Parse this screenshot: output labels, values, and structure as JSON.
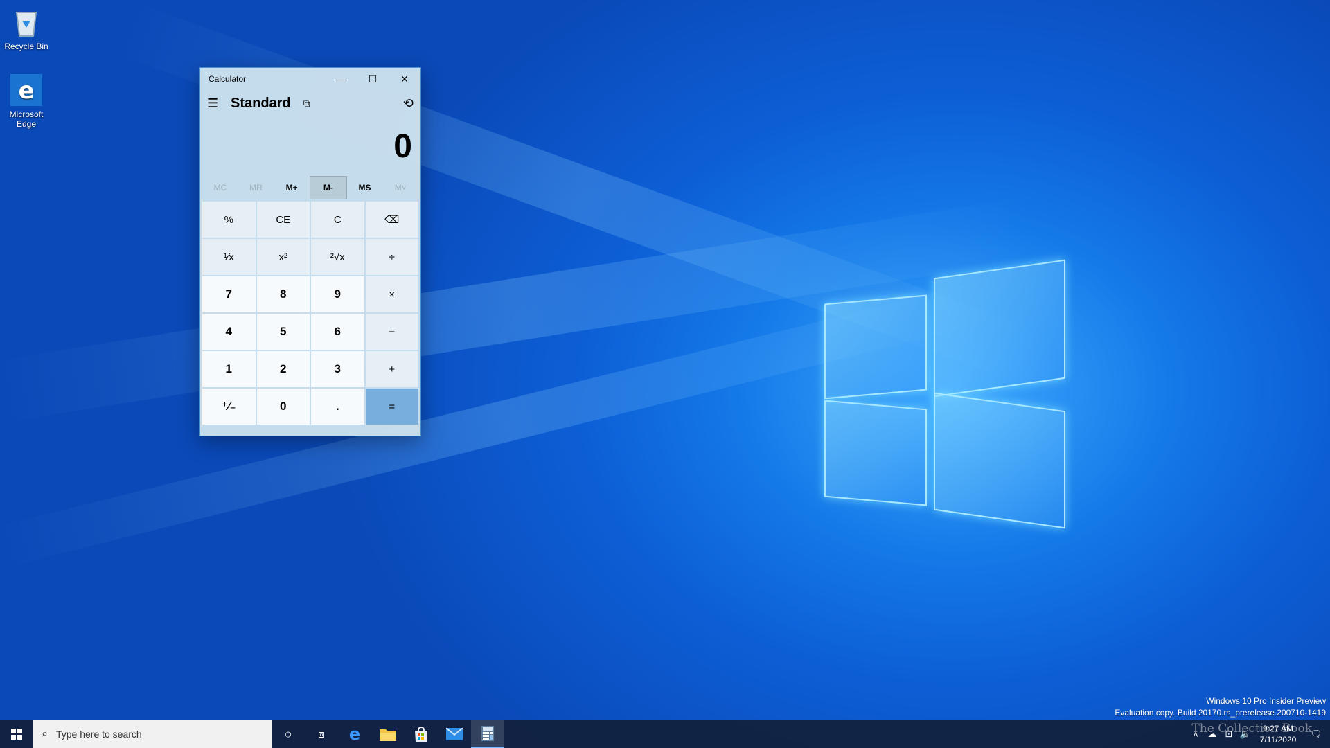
{
  "desktop": {
    "icons": [
      {
        "label": "Recycle Bin",
        "icon": "recycle-bin-icon"
      },
      {
        "label": "Microsoft Edge",
        "icon": "edge-icon"
      }
    ]
  },
  "calculator": {
    "title": "Calculator",
    "mode": "Standard",
    "display_value": "0",
    "memory_buttons": [
      {
        "label": "MC",
        "enabled": false
      },
      {
        "label": "MR",
        "enabled": false
      },
      {
        "label": "M+",
        "enabled": true
      },
      {
        "label": "M-",
        "enabled": true
      },
      {
        "label": "MS",
        "enabled": true
      },
      {
        "label": "M˅",
        "enabled": false
      }
    ],
    "keys": [
      {
        "label": "%",
        "kind": "fn",
        "name": "percent-key"
      },
      {
        "label": "CE",
        "kind": "fn",
        "name": "clear-entry-key"
      },
      {
        "label": "C",
        "kind": "fn",
        "name": "clear-key"
      },
      {
        "label": "⌫",
        "kind": "fn",
        "name": "backspace-key"
      },
      {
        "label": "¹⁄x",
        "kind": "fn",
        "name": "reciprocal-key"
      },
      {
        "label": "x²",
        "kind": "fn",
        "name": "square-key"
      },
      {
        "label": "²√x",
        "kind": "fn",
        "name": "square-root-key"
      },
      {
        "label": "÷",
        "kind": "fn",
        "name": "divide-key"
      },
      {
        "label": "7",
        "kind": "num",
        "name": "digit-7-key"
      },
      {
        "label": "8",
        "kind": "num",
        "name": "digit-8-key"
      },
      {
        "label": "9",
        "kind": "num",
        "name": "digit-9-key"
      },
      {
        "label": "×",
        "kind": "fn",
        "name": "multiply-key"
      },
      {
        "label": "4",
        "kind": "num",
        "name": "digit-4-key"
      },
      {
        "label": "5",
        "kind": "num",
        "name": "digit-5-key"
      },
      {
        "label": "6",
        "kind": "num",
        "name": "digit-6-key"
      },
      {
        "label": "−",
        "kind": "fn",
        "name": "subtract-key"
      },
      {
        "label": "1",
        "kind": "num",
        "name": "digit-1-key"
      },
      {
        "label": "2",
        "kind": "num",
        "name": "digit-2-key"
      },
      {
        "label": "3",
        "kind": "num",
        "name": "digit-3-key"
      },
      {
        "label": "+",
        "kind": "fn",
        "name": "add-key"
      },
      {
        "label": "⁺⁄₋",
        "kind": "num",
        "name": "negate-key"
      },
      {
        "label": "0",
        "kind": "num",
        "name": "digit-0-key"
      },
      {
        "label": ".",
        "kind": "num",
        "name": "decimal-key"
      },
      {
        "label": "=",
        "kind": "eq",
        "name": "equals-key"
      }
    ]
  },
  "taskbar": {
    "search_placeholder": "Type here to search",
    "pinned_apps": [
      "edge-icon",
      "file-explorer-icon",
      "store-icon",
      "mail-icon",
      "calculator-icon"
    ],
    "active_app": "calculator-icon",
    "time": "9:27 AM",
    "date": "7/11/2020"
  },
  "watermark": {
    "line1": "Windows 10 Pro Insider Preview",
    "line2": "Evaluation copy. Build 20170.rs_prerelease.200710-1419"
  },
  "brand": "The Collection Book",
  "colors": {
    "accent": "#0078d7",
    "equals_key": "#77aede",
    "taskbar": "#12203a"
  }
}
